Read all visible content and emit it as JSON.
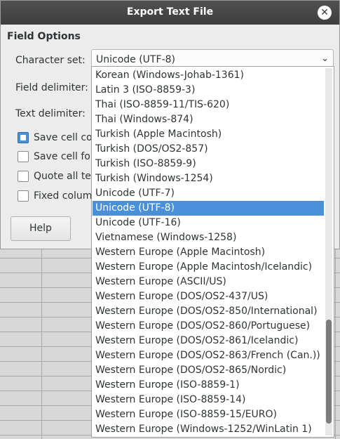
{
  "dialog": {
    "title": "Export Text File",
    "section_title": "Field Options",
    "labels": {
      "character_set": "Character set:",
      "field_delimiter": "Field delimiter:",
      "text_delimiter": "Text delimiter:"
    },
    "character_set_value": "Unicode (UTF-8)",
    "checkboxes": [
      {
        "label": "Save cell con",
        "checked": true
      },
      {
        "label": "Save cell form",
        "checked": false
      },
      {
        "label": "Quote all tex",
        "checked": false
      },
      {
        "label": "Fixed column",
        "checked": false
      }
    ],
    "help_label": "Help"
  },
  "dropdown": {
    "selected_index": 9,
    "options": [
      "Korean (Windows-Johab-1361)",
      "Latin 3 (ISO-8859-3)",
      "Thai (ISO-8859-11/TIS-620)",
      "Thai (Windows-874)",
      "Turkish (Apple Macintosh)",
      "Turkish (DOS/OS2-857)",
      "Turkish (ISO-8859-9)",
      "Turkish (Windows-1254)",
      "Unicode (UTF-7)",
      "Unicode (UTF-8)",
      "Unicode (UTF-16)",
      "Vietnamese (Windows-1258)",
      "Western Europe (Apple Macintosh)",
      "Western Europe (Apple Macintosh/Icelandic)",
      "Western Europe (ASCII/US)",
      "Western Europe (DOS/OS2-437/US)",
      "Western Europe (DOS/OS2-850/International)",
      "Western Europe (DOS/OS2-860/Portuguese)",
      "Western Europe (DOS/OS2-861/Icelandic)",
      "Western Europe (DOS/OS2-863/French (Can.))",
      "Western Europe (DOS/OS2-865/Nordic)",
      "Western Europe (ISO-8859-1)",
      "Western Europe (ISO-8859-14)",
      "Western Europe (ISO-8859-15/EURO)",
      "Western Europe (Windows-1252/WinLatin 1)"
    ]
  },
  "colors": {
    "titlebar": "#444444",
    "selection": "#4a90d9",
    "dialog_bg": "#ececec"
  },
  "icons": {
    "close": "close-icon",
    "combo_arrow": "chevron-down-icon"
  }
}
